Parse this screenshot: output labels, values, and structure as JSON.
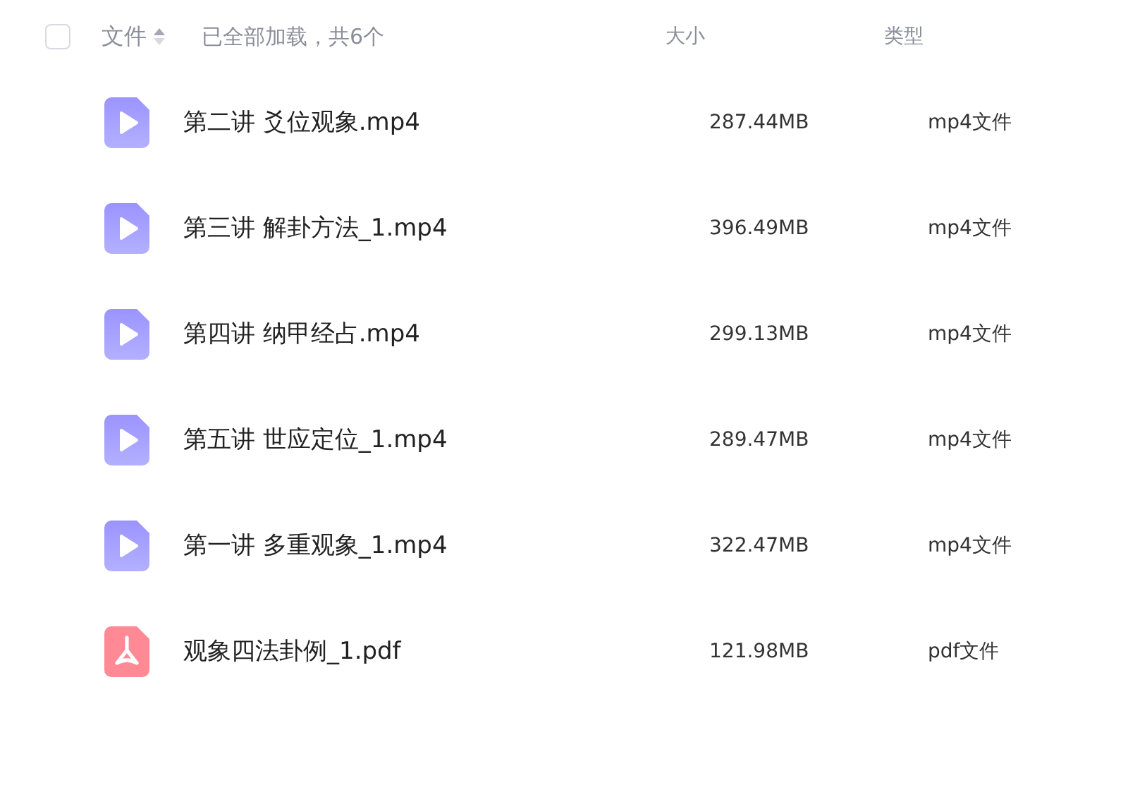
{
  "header": {
    "select_all": {
      "checked": false
    },
    "name_column": "文件",
    "status": "已全部加载，共6个",
    "size_column": "大小",
    "type_column": "类型"
  },
  "files": [
    {
      "kind": "video",
      "name": "第二讲 爻位观象.mp4",
      "size": "287.44MB",
      "type": "mp4文件"
    },
    {
      "kind": "video",
      "name": "第三讲 解卦方法_1.mp4",
      "size": "396.49MB",
      "type": "mp4文件"
    },
    {
      "kind": "video",
      "name": "第四讲 纳甲经占.mp4",
      "size": "299.13MB",
      "type": "mp4文件"
    },
    {
      "kind": "video",
      "name": "第五讲 世应定位_1.mp4",
      "size": "289.47MB",
      "type": "mp4文件"
    },
    {
      "kind": "video",
      "name": "第一讲 多重观象_1.mp4",
      "size": "322.47MB",
      "type": "mp4文件"
    },
    {
      "kind": "pdf",
      "name": "观象四法卦例_1.pdf",
      "size": "121.98MB",
      "type": "pdf文件"
    }
  ]
}
